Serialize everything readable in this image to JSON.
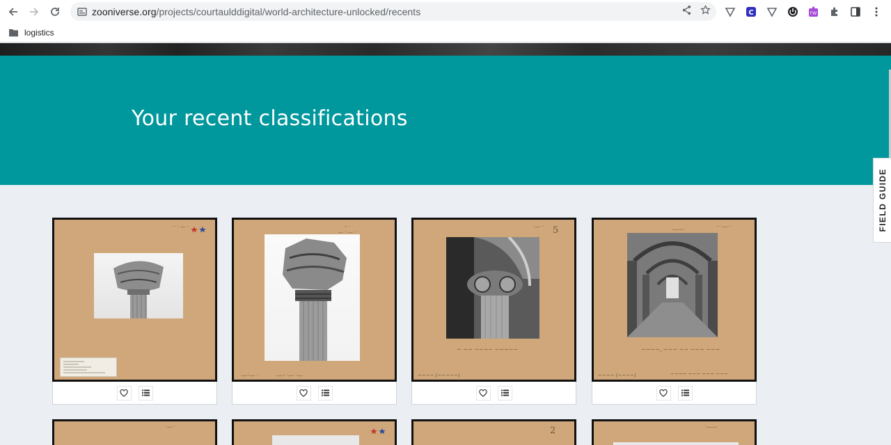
{
  "browser": {
    "url_host": "zooniverse.org",
    "url_path": "/projects/courtaulddigital/world-architecture-unlocked/recents",
    "bookmark_label": "logistics",
    "extensions": [
      "shield-icon",
      "c-extension-icon",
      "shield-outline-icon",
      "power-icon",
      "puzzle-fw-icon",
      "puzzle-icon",
      "sidepanel-icon",
      "menu-icon"
    ]
  },
  "page": {
    "title": "Your recent classifications",
    "field_guide_label": "FIELD GUIDE"
  },
  "cards": [
    {
      "caption": "",
      "has_stars": true
    },
    {
      "caption": "",
      "has_stars": false
    },
    {
      "caption": "",
      "has_stars": false
    },
    {
      "caption": "",
      "has_stars": false
    }
  ],
  "colors": {
    "hero": "#00979d",
    "page_bg": "#ebeef3",
    "mount": "#cfa77a"
  }
}
